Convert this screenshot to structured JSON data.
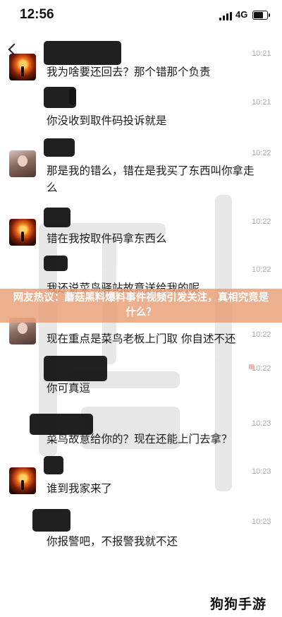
{
  "status_bar": {
    "time": "12:56",
    "network": "4G"
  },
  "headline": "网友热议：蘑菇黑料爆料事件视频引发关注，真相究竟是什么？",
  "messages": [
    {
      "avatar": "sunset",
      "time": "10:21",
      "text": "我为啥要还回去？那个错那个负责"
    },
    {
      "avatar": "none",
      "time": "10:21",
      "text": "你没收到取件码投诉就是"
    },
    {
      "avatar": "girl",
      "time": "10:22",
      "text": "那是我的错么，错在是我买了东西叫你拿走么"
    },
    {
      "avatar": "sunset",
      "time": "10:22",
      "text": "错在我按取件码拿东西么"
    },
    {
      "avatar": "none",
      "time": "10:22",
      "text": "我还说菜鸟驿站故意送给我的呢"
    },
    {
      "avatar": "girl",
      "time": "10:22",
      "text": "现在重点是菜鸟老板上门取 你自述不还"
    },
    {
      "avatar": "none",
      "time": "10:22",
      "text": "你可真逗"
    },
    {
      "avatar": "none",
      "time": "10:23",
      "text": "菜鸟故意给你的？现在还能上门去拿？"
    },
    {
      "avatar": "sunset",
      "time": "10:23",
      "text": "谁到我家来了"
    },
    {
      "avatar": "none",
      "time": "10:23",
      "text": "你报警吧，不报警我就不还"
    }
  ],
  "site_logo": "狗狗手游",
  "icons": {
    "back": "back-arrow-icon",
    "signal": "signal-icon",
    "battery": "battery-icon"
  }
}
